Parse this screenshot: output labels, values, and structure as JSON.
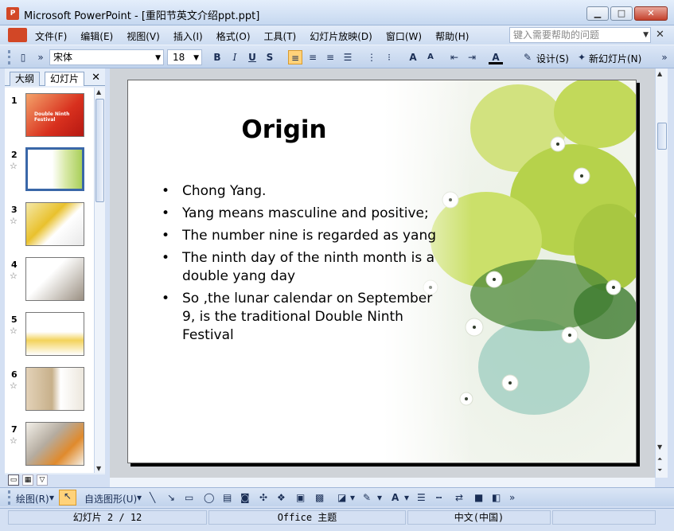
{
  "window": {
    "app_icon": "powerpoint-icon",
    "title": "Microsoft PowerPoint - [重阳节英文介绍ppt.ppt]",
    "btn_min": "▁",
    "btn_max": "□",
    "btn_close": "✕"
  },
  "menubar": {
    "items": [
      "文件(F)",
      "编辑(E)",
      "视图(V)",
      "插入(I)",
      "格式(O)",
      "工具(T)",
      "幻灯片放映(D)",
      "窗口(W)",
      "帮助(H)"
    ],
    "help_placeholder": "键入需要帮助的问题",
    "close_glyph": "✕"
  },
  "toolbar": {
    "font_name": "宋体",
    "font_size": "18",
    "bold": "B",
    "italic": "I",
    "underline": "U",
    "shadow": "S",
    "design_label": "设计(S)",
    "new_slide_label": "新幻灯片(N)"
  },
  "leftpane": {
    "tab_outline": "大纲",
    "tab_slides": "幻灯片",
    "close_glyph": "✕",
    "slides": [
      {
        "num": "1",
        "title": "Double Ninth Festival"
      },
      {
        "num": "2"
      },
      {
        "num": "3"
      },
      {
        "num": "4"
      },
      {
        "num": "5"
      },
      {
        "num": "6"
      },
      {
        "num": "7"
      }
    ]
  },
  "slide": {
    "title": "Origin",
    "bullets": [
      "Chong Yang.",
      "Yang means masculine and positive;",
      "The number nine is regarded as yang",
      "The ninth day of the ninth month is a double yang day",
      "So ,the lunar calendar on September 9, is the traditional Double Ninth Festival"
    ]
  },
  "drawbar": {
    "draw_label": "绘图(R)",
    "autoshape_label": "自选图形(U)"
  },
  "status": {
    "slide_pos": "幻灯片 2 / 12",
    "theme": "Office 主题",
    "language": "中文(中国)"
  },
  "colors": {
    "accent": "#d24726",
    "selection": "#3a67a8"
  }
}
